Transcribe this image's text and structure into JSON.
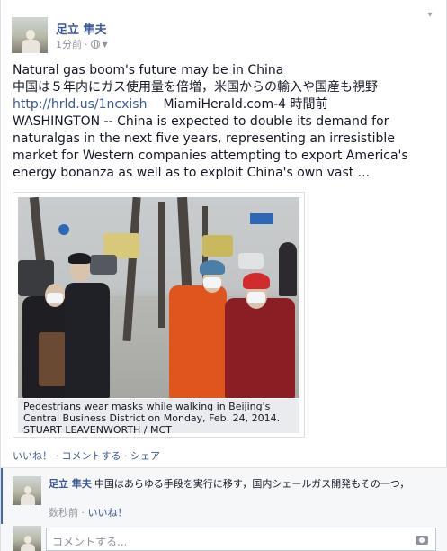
{
  "post": {
    "author": "足立 隼夫",
    "time": "1分前",
    "privacy_icon": "globe-icon",
    "text_line1": "Natural gas boom's future may be in China",
    "text_line2": "中国は５年内にガス使用量を倍増，米国からの輸入や国産も視野",
    "link": "http://hrld.us/1ncxish",
    "link_source": "MiamiHerald.com-4 時間前",
    "body": "WASHINGTON -- China is expected to double its demand for naturalgas in the next five years, representing an irresistible market for Western companies attempting to export America's energy bonanza as well as to exploit China's own vast ...",
    "photo_caption": "Pedestrians wear masks while walking in Beijing's Central Business District on Monday, Feb. 24, 2014.  STUART LEAVENWORTH / MCT",
    "actions": {
      "like": "いいね！",
      "comment": "コメントする",
      "share": "シェア",
      "sep1": " · ",
      "sep2": " · "
    }
  },
  "comment": {
    "author": "足立 隼夫",
    "text": "中国はあらゆる手段を実行に移す，国内シェールガス開発もその一つ，",
    "time": "数秒前",
    "sep": " · ",
    "like": "いいね！"
  },
  "reply": {
    "placeholder": "コメントする..."
  }
}
